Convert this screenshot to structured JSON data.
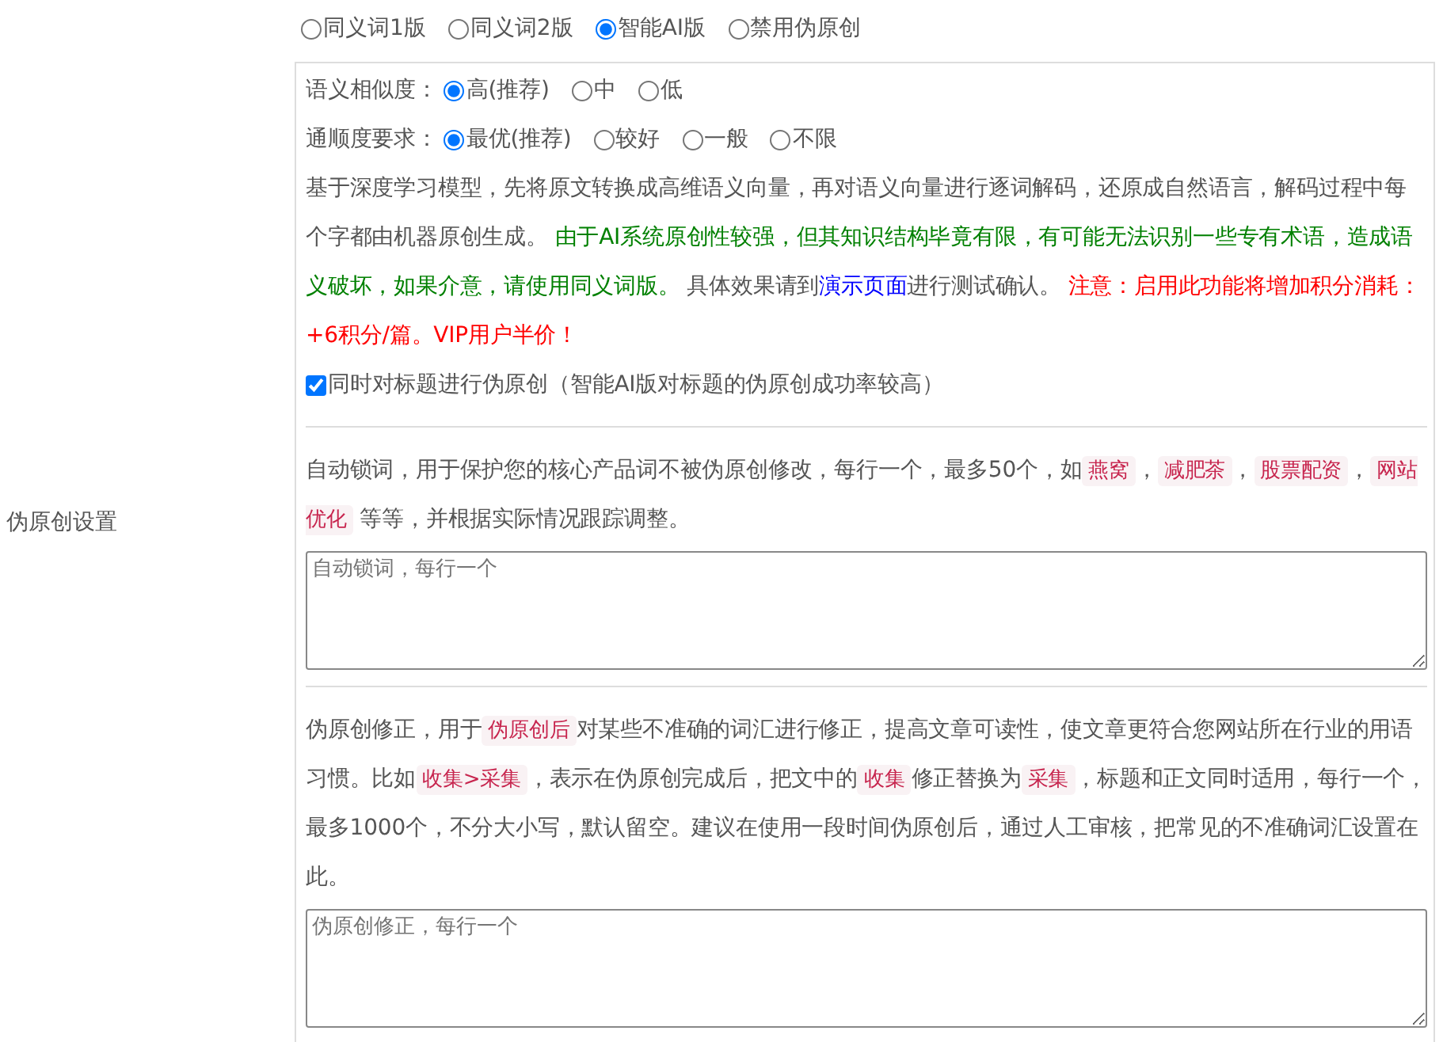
{
  "section_label": "伪原创设置",
  "modes": [
    {
      "label": "同义词1版",
      "selected": false
    },
    {
      "label": "同义词2版",
      "selected": false
    },
    {
      "label": "智能AI版",
      "selected": true
    },
    {
      "label": "禁用伪原创",
      "selected": false
    }
  ],
  "similarity": {
    "label": "语义相似度：",
    "options": [
      {
        "label": "高(推荐)",
        "selected": true
      },
      {
        "label": "中",
        "selected": false
      },
      {
        "label": "低",
        "selected": false
      }
    ]
  },
  "fluency": {
    "label": "通顺度要求：",
    "options": [
      {
        "label": "最优(推荐)",
        "selected": true
      },
      {
        "label": "较好",
        "selected": false
      },
      {
        "label": "一般",
        "selected": false
      },
      {
        "label": "不限",
        "selected": false
      }
    ]
  },
  "ai_description": [
    {
      "kind": "plain",
      "text": "基于深度学习模型，先将原文转换成高维语义向量，再对语义向量进行逐词解码，还原成自然语言，解码过程中每个字都由机器原创生成。 "
    },
    {
      "kind": "notice",
      "text": "由于AI系统原创性较强，但其知识结构毕竟有限，有可能无法识别一些专有术语，造成语义破坏，如果介意，请使用同义词版。"
    },
    {
      "kind": "plain",
      "text": " 具体效果请到"
    },
    {
      "kind": "link",
      "text": "演示页面"
    },
    {
      "kind": "plain",
      "text": "进行测试确认。 "
    },
    {
      "kind": "warning",
      "text": "注意：启用此功能将增加积分消耗：+6积分/篇。VIP用户半价！"
    }
  ],
  "title_option": {
    "label": "同时对标题进行伪原创（智能AI版对标题的伪原创成功率较高）",
    "checked": true
  },
  "lock_words": {
    "description": [
      {
        "kind": "plain",
        "text": "自动锁词，用于保护您的核心产品词不被伪原创修改，每行一个，最多50个，如"
      },
      {
        "kind": "code",
        "text": "燕窝"
      },
      {
        "kind": "plain",
        "text": "，"
      },
      {
        "kind": "code",
        "text": "减肥茶"
      },
      {
        "kind": "plain",
        "text": "，"
      },
      {
        "kind": "code",
        "text": "股票配资"
      },
      {
        "kind": "plain",
        "text": "，"
      },
      {
        "kind": "code",
        "text": "网站优化"
      },
      {
        "kind": "plain",
        "text": " 等等，并根据实际情况跟踪调整。"
      }
    ],
    "placeholder": "自动锁词，每行一个"
  },
  "correction": {
    "description": [
      {
        "kind": "plain",
        "text": "伪原创修正，用于"
      },
      {
        "kind": "code",
        "text": "伪原创后"
      },
      {
        "kind": "plain",
        "text": "对某些不准确的词汇进行修正，提高文章可读性，使文章更符合您网站所在行业的用语习惯。比如"
      },
      {
        "kind": "code",
        "text": "收集>采集"
      },
      {
        "kind": "plain",
        "text": "，表示在伪原创完成后，把文中的"
      },
      {
        "kind": "code",
        "text": "收集"
      },
      {
        "kind": "plain",
        "text": "修正替换为"
      },
      {
        "kind": "code",
        "text": "采集"
      },
      {
        "kind": "plain",
        "text": "，标题和正文同时适用，每行一个，最多1000个，不分大小写，默认留空。建议在使用一段时间伪原创后，通过人工审核，把常见的不准确词汇设置在此。"
      }
    ],
    "placeholder": "伪原创修正，每行一个"
  }
}
